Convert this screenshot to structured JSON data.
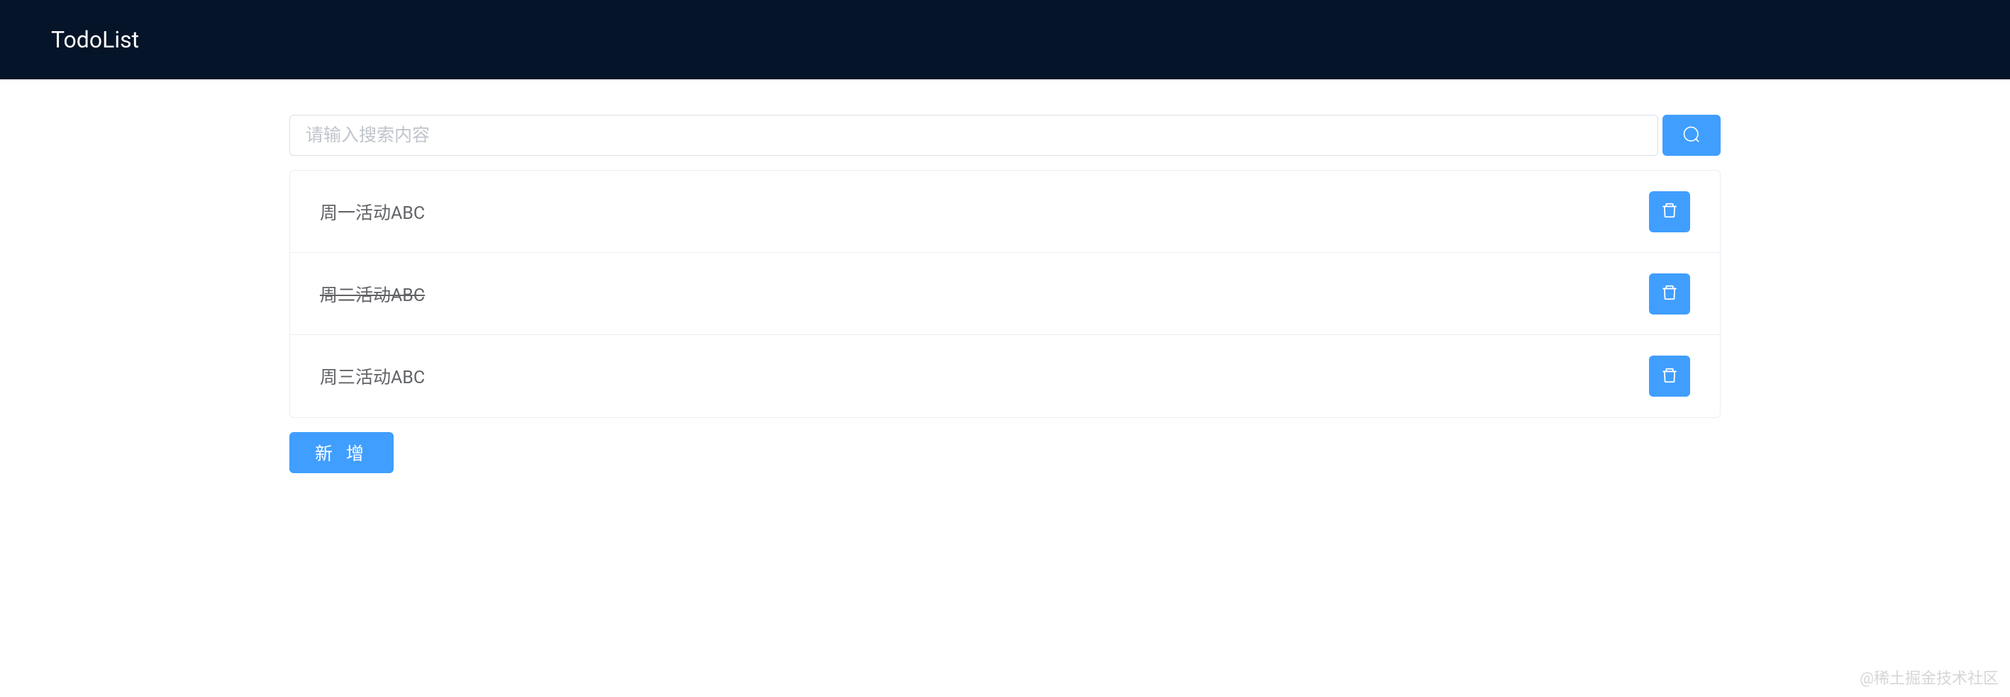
{
  "header": {
    "title": "TodoList"
  },
  "search": {
    "placeholder": "请输入搜索内容",
    "value": ""
  },
  "todos": [
    {
      "text": "周一活动ABC",
      "completed": false
    },
    {
      "text": "周二活动ABC",
      "completed": true
    },
    {
      "text": "周三活动ABC",
      "completed": false
    }
  ],
  "buttons": {
    "add_label": "新 增"
  },
  "watermark": "@稀土掘金技术社区"
}
